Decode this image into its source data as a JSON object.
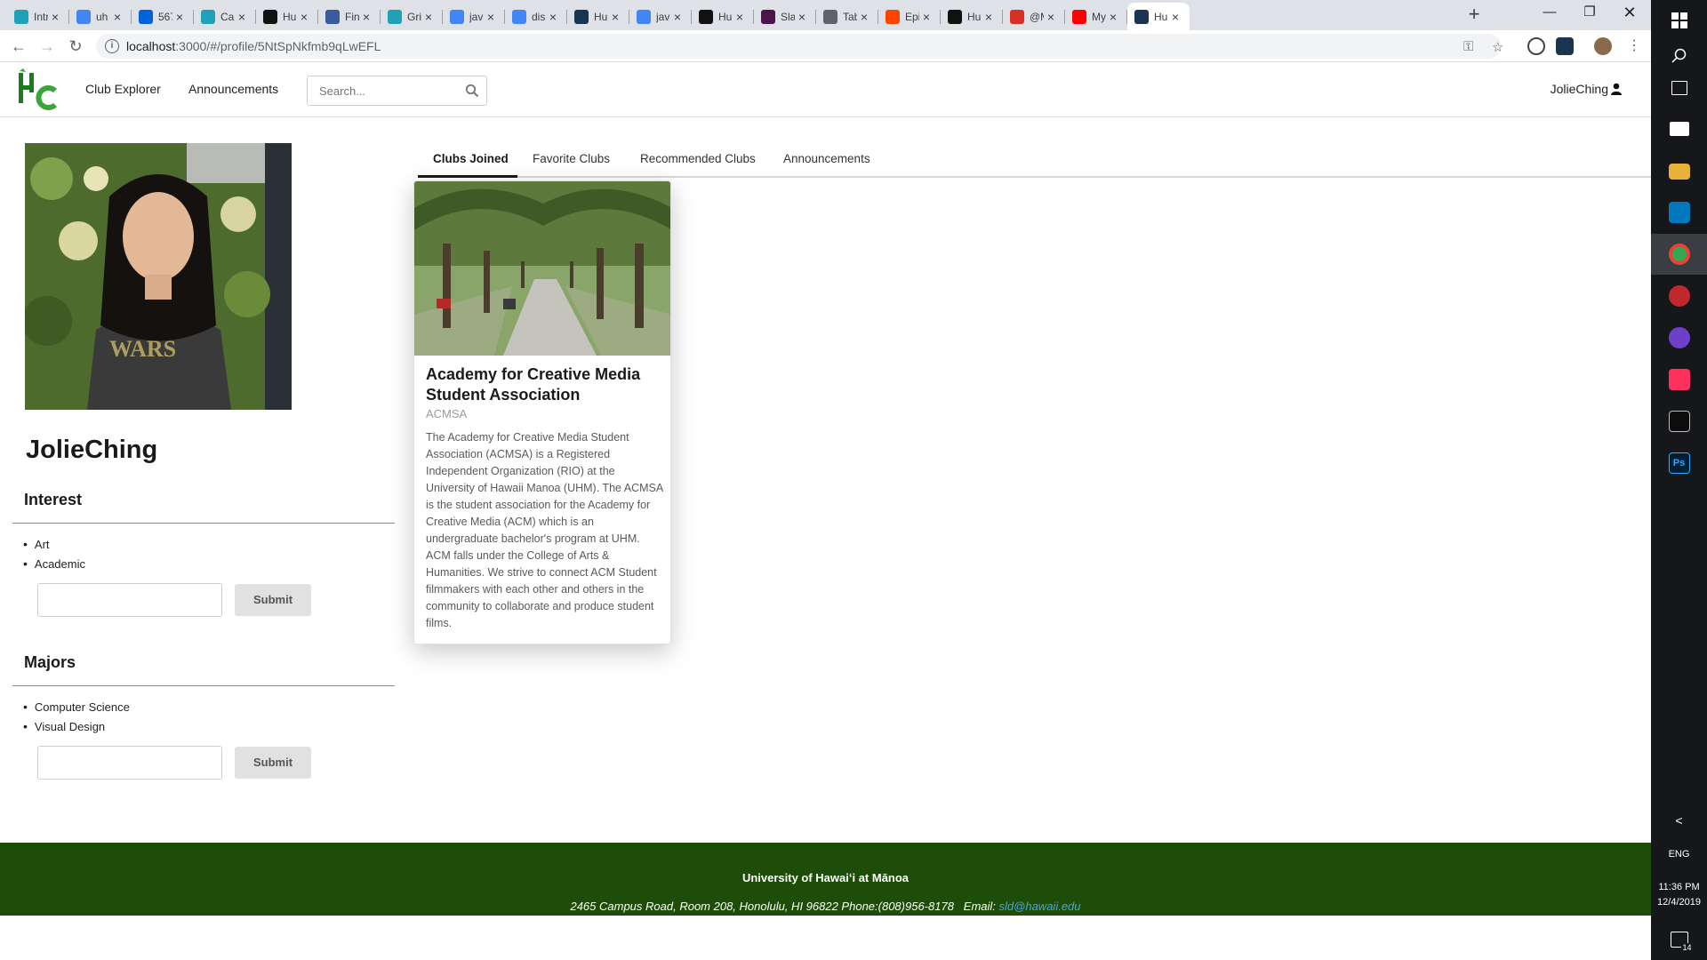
{
  "browser": {
    "tabs": [
      {
        "title": "Intro",
        "favicon": "react-icon",
        "color": "#1fa2b8"
      },
      {
        "title": "uh r",
        "favicon": "google-icon",
        "color": "#4285f4"
      },
      {
        "title": "567",
        "favicon": "flickr-icon",
        "color": "#0063dc"
      },
      {
        "title": "Card",
        "favicon": "react-icon",
        "color": "#1fa2b8"
      },
      {
        "title": "Hub",
        "favicon": "github-icon",
        "color": "#111111"
      },
      {
        "title": "Fina",
        "favicon": "doc-icon",
        "color": "#3a5ba0"
      },
      {
        "title": "Grid",
        "favicon": "react-icon",
        "color": "#1fa2b8"
      },
      {
        "title": "java",
        "favicon": "google-icon",
        "color": "#4285f4"
      },
      {
        "title": "disp",
        "favicon": "google-icon",
        "color": "#4285f4"
      },
      {
        "title": "Hub",
        "favicon": "hub-icon",
        "color": "#1a3550"
      },
      {
        "title": "java",
        "favicon": "google-icon",
        "color": "#4285f4"
      },
      {
        "title": "Hub",
        "favicon": "github-icon",
        "color": "#111111"
      },
      {
        "title": "Slac",
        "favicon": "slack-icon",
        "color": "#4a154b"
      },
      {
        "title": "Tabl",
        "favicon": "globe-icon",
        "color": "#5f6368"
      },
      {
        "title": "Epic",
        "favicon": "reddit-icon",
        "color": "#ff4500"
      },
      {
        "title": "Hub",
        "favicon": "github-icon",
        "color": "#111111"
      },
      {
        "title": "@M",
        "favicon": "notification-icon",
        "color": "#d93025"
      },
      {
        "title": "My",
        "favicon": "youtube-icon",
        "color": "#ff0000"
      },
      {
        "title": "Hub",
        "favicon": "hub-icon",
        "color": "#1a3550"
      }
    ],
    "url_host": "localhost",
    "url_path": ":3000/#/profile/5NtSpNkfmb9qLwEFL"
  },
  "taskbar": {
    "language": "ENG",
    "time": "11:36 PM",
    "date": "12/4/2019",
    "notification_count": "14"
  },
  "nav": {
    "club_explorer": "Club Explorer",
    "announcements": "Announcements",
    "search_placeholder": "Search...",
    "username": "JolieChing"
  },
  "profile": {
    "name": "JolieChing",
    "interest_heading": "Interest",
    "interests": [
      "Art",
      "Academic"
    ],
    "majors_heading": "Majors",
    "majors": [
      "Computer Science",
      "Visual Design"
    ],
    "submit_label": "Submit"
  },
  "tabs": {
    "items": [
      "Clubs Joined",
      "Favorite Clubs",
      "Recommended Clubs",
      "Announcements"
    ],
    "active": "Clubs Joined"
  },
  "club": {
    "title": "Academy for Creative Media Student Association",
    "abbr": "ACMSA",
    "description": "The Academy for Creative Media Student Association (ACMSA) is a Registered Independent Organization (RIO) at the University of Hawaii Manoa (UHM). The ACMSA is the student association for the Academy for Creative Media (ACM) which is an undergraduate bachelor's program at UHM. ACM falls under the College of Arts & Humanities. We strive to connect ACM Student filmmakers with each other and others in the community to collaborate and produce student films."
  },
  "footer": {
    "university": "University of Hawaiʻi at Mānoa",
    "address": "2465 Campus Road, Room 208, Honolulu, HI 96822 Phone:(808)956-8178",
    "email_label": "Email:",
    "email": "sld@hawaii.edu"
  },
  "colors": {
    "footer_bg": "#1e4d09",
    "logo_green": "#3aa53a",
    "taskbar_bg": "#15171a"
  }
}
